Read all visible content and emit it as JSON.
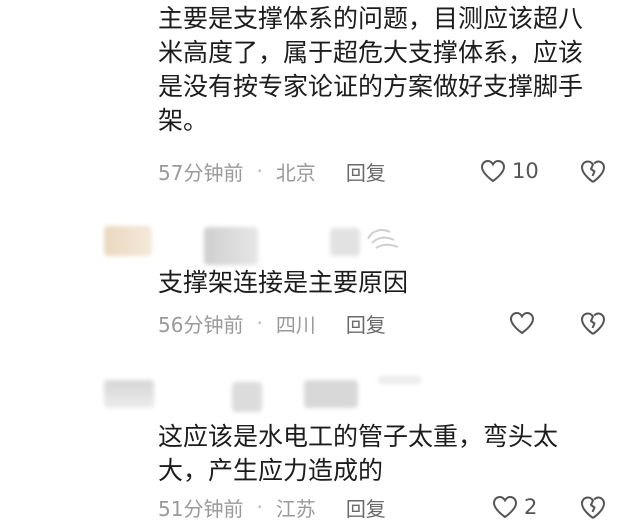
{
  "comments": [
    {
      "text_lines": [
        "主要是支撑体系的问题，目测应该超八",
        "米高度了，属于超危大支撑体系，应该",
        "是没有按专家论证的方案做好支撑脚手",
        "架。"
      ],
      "time": "57分钟前",
      "location": "北京",
      "reply_label": "回复",
      "like_count": "10"
    },
    {
      "text_lines": [
        "支撑架连接是主要原因"
      ],
      "time": "56分钟前",
      "location": "四川",
      "reply_label": "回复",
      "like_count": ""
    },
    {
      "text_lines": [
        "这应该是水电工的管子太重，弯头太",
        "大，产生应力造成的"
      ],
      "time": "51分钟前",
      "location": "江苏",
      "reply_label": "回复",
      "like_count": "2"
    }
  ],
  "separator_dot": "·",
  "icons": {
    "like": "heart-outline-icon",
    "dislike": "broken-heart-icon"
  },
  "colors": {
    "text": "#1c1c1c",
    "meta": "#9a9a9a",
    "reply": "#6a6a6a"
  }
}
